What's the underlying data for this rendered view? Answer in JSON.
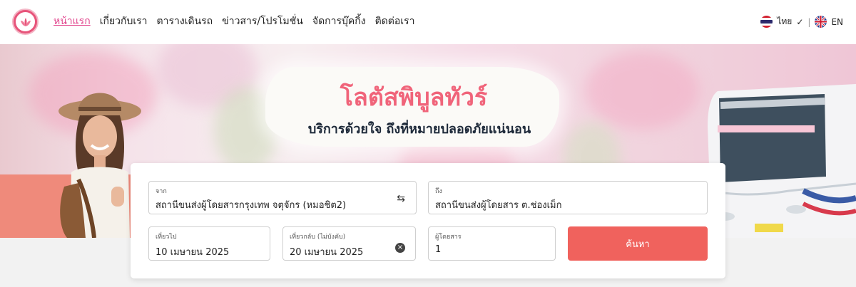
{
  "nav": {
    "items": [
      "หน้าแรก",
      "เกี่ยวกับเรา",
      "ตารางเดินรถ",
      "ข่าวสาร/โปรโมชั่น",
      "จัดการบุ๊คกิ้ง",
      "ติดต่อเรา"
    ],
    "lang_th": "ไทย",
    "lang_en": "EN"
  },
  "hero": {
    "title": "โลตัสพิบูลทัวร์",
    "subtitle": "บริการด้วยใจ ถึงที่หมายปลอดภัยแน่นอน"
  },
  "search": {
    "from_label": "จาก",
    "from_value": "สถานีขนส่งผู้โดยสารกรุงเทพ จตุจักร (หมอชิต2)",
    "to_label": "ถึง",
    "to_value": "สถานีขนส่งผู้โดยสาร ต.ช่องเม็ก",
    "depart_label": "เที่ยวไป",
    "depart_value": "10 เมษายน 2025",
    "return_label": "เที่ยวกลับ (ไม่บังคับ)",
    "return_value": "20 เมษายน 2025",
    "pax_label": "ผู้โดยสาร",
    "pax_value": "1",
    "button_label": "ค้นหา"
  },
  "colors": {
    "accent": "#f0625d",
    "nav_active": "#e2488f",
    "title": "#f0647a"
  },
  "icons": [
    "logo",
    "thai-flag-icon",
    "check-icon",
    "uk-flag-icon",
    "swap-icon",
    "clear-icon"
  ]
}
